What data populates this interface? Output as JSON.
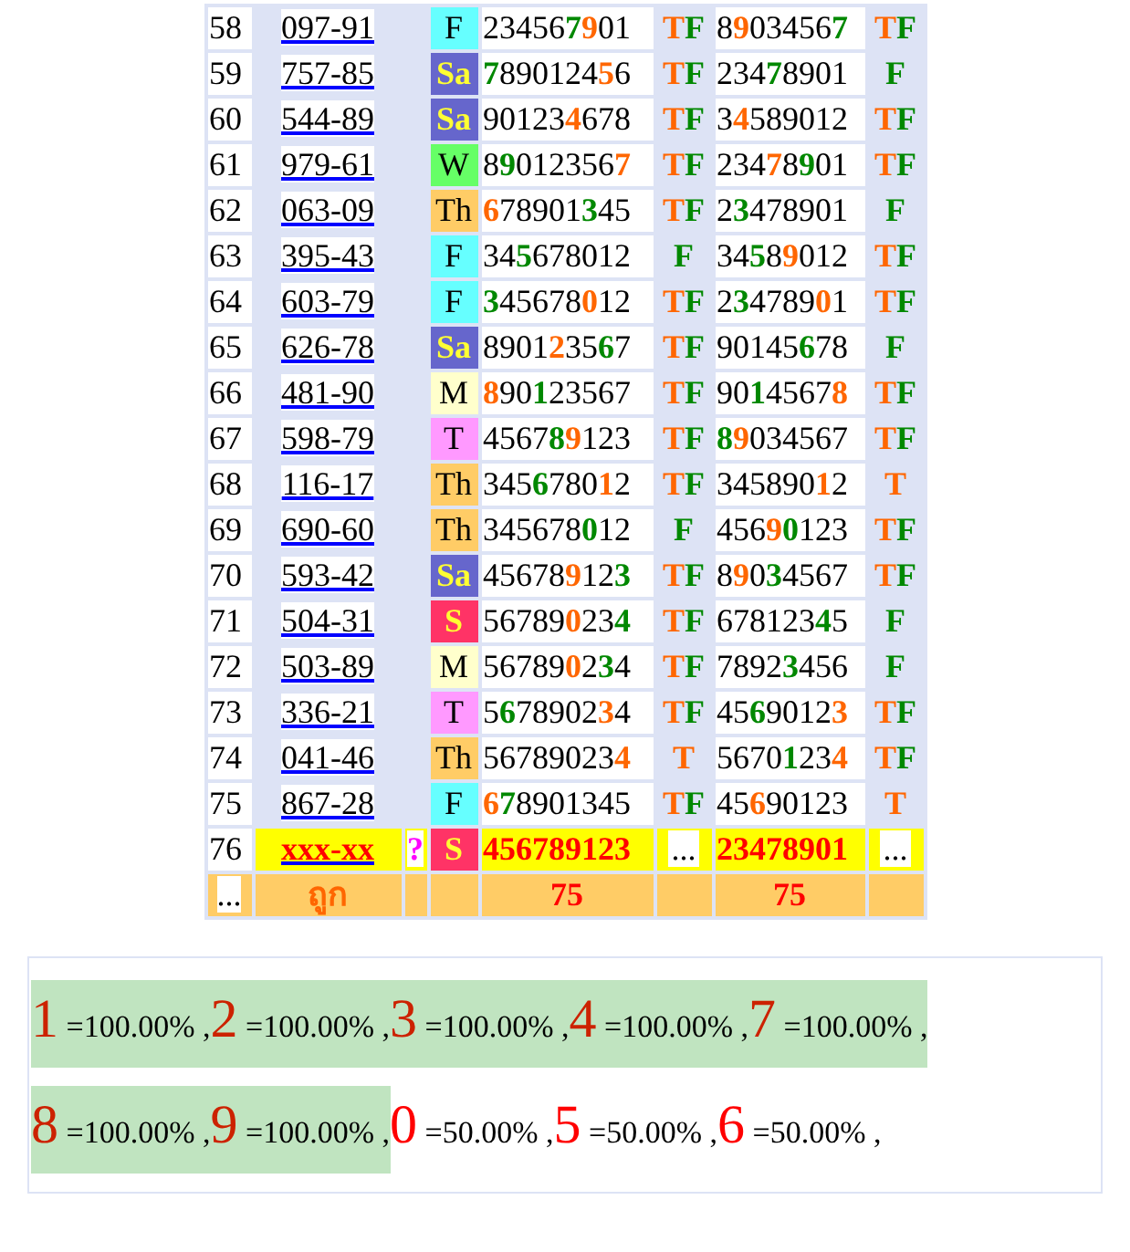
{
  "rows": [
    {
      "kind": "done",
      "num": "58",
      "code": "097-91",
      "day": "F",
      "color": "#66ffff",
      "n1": [
        {
          "text": "23456"
        },
        {
          "text": "7",
          "color": "#008800"
        },
        {
          "text": "9",
          "color": "#ff6600"
        },
        {
          "text": "01"
        }
      ],
      "t1": [
        {
          "text": "T",
          "color": "#ff6600"
        },
        {
          "text": "F",
          "color": "#008800"
        }
      ],
      "n2": [
        {
          "text": "8"
        },
        {
          "text": "9",
          "color": "#ff6600"
        },
        {
          "text": "03456"
        },
        {
          "text": "7",
          "color": "#008800"
        }
      ],
      "t2": [
        {
          "text": "T",
          "color": "#ff6600"
        },
        {
          "text": "F",
          "color": "#008800"
        }
      ]
    },
    {
      "kind": "done",
      "num": "59",
      "code": "757-85",
      "day": "Sa",
      "color": "#6666cc",
      "n1": [
        {
          "text": "7",
          "color": "#008800"
        },
        {
          "text": "890124"
        },
        {
          "text": "5",
          "color": "#ff6600"
        },
        {
          "text": "6"
        }
      ],
      "t1": [
        {
          "text": "T",
          "color": "#ff6600"
        },
        {
          "text": "F",
          "color": "#008800"
        }
      ],
      "n2": [
        {
          "text": "234"
        },
        {
          "text": "7",
          "color": "#008800"
        },
        {
          "text": "8901"
        }
      ],
      "t2": [
        {
          "text": "F",
          "color": "#008800"
        }
      ]
    },
    {
      "kind": "done",
      "num": "60",
      "code": "544-89",
      "day": "Sa",
      "color": "#6666cc",
      "n1": [
        {
          "text": "90123"
        },
        {
          "text": "4",
          "color": "#ff6600"
        },
        {
          "text": "678"
        }
      ],
      "t1": [
        {
          "text": "T",
          "color": "#ff6600"
        },
        {
          "text": "F",
          "color": "#008800"
        }
      ],
      "n2": [
        {
          "text": "3"
        },
        {
          "text": "4",
          "color": "#ff6600"
        },
        {
          "text": "589012"
        }
      ],
      "t2": [
        {
          "text": "T",
          "color": "#ff6600"
        },
        {
          "text": "F",
          "color": "#008800"
        }
      ]
    },
    {
      "kind": "done",
      "num": "61",
      "code": "979-61",
      "day": "W",
      "color": "#66ff66",
      "n1": [
        {
          "text": "8"
        },
        {
          "text": "9",
          "color": "#008800"
        },
        {
          "text": "012356"
        },
        {
          "text": "7",
          "color": "#ff6600"
        }
      ],
      "t1": [
        {
          "text": "T",
          "color": "#ff6600"
        },
        {
          "text": "F",
          "color": "#008800"
        }
      ],
      "n2": [
        {
          "text": "234"
        },
        {
          "text": "7",
          "color": "#ff6600"
        },
        {
          "text": "8"
        },
        {
          "text": "9",
          "color": "#008800"
        },
        {
          "text": "01"
        }
      ],
      "t2": [
        {
          "text": "T",
          "color": "#ff6600"
        },
        {
          "text": "F",
          "color": "#008800"
        }
      ]
    },
    {
      "kind": "done",
      "num": "62",
      "code": "063-09",
      "day": "Th",
      "color": "#ffcc66",
      "n1": [
        {
          "text": "6",
          "color": "#ff6600"
        },
        {
          "text": "78901"
        },
        {
          "text": "3",
          "color": "#008800"
        },
        {
          "text": "45"
        }
      ],
      "t1": [
        {
          "text": "T",
          "color": "#ff6600"
        },
        {
          "text": "F",
          "color": "#008800"
        }
      ],
      "n2": [
        {
          "text": "2"
        },
        {
          "text": "3",
          "color": "#008800"
        },
        {
          "text": "478901"
        }
      ],
      "t2": [
        {
          "text": "F",
          "color": "#008800"
        }
      ]
    },
    {
      "kind": "done",
      "num": "63",
      "code": "395-43",
      "day": "F",
      "color": "#66ffff",
      "n1": [
        {
          "text": "34"
        },
        {
          "text": "5",
          "color": "#008800"
        },
        {
          "text": "678012"
        }
      ],
      "t1": [
        {
          "text": "F",
          "color": "#008800"
        }
      ],
      "n2": [
        {
          "text": "34"
        },
        {
          "text": "5",
          "color": "#008800"
        },
        {
          "text": "8"
        },
        {
          "text": "9",
          "color": "#ff6600"
        },
        {
          "text": "012"
        }
      ],
      "t2": [
        {
          "text": "T",
          "color": "#ff6600"
        },
        {
          "text": "F",
          "color": "#008800"
        }
      ]
    },
    {
      "kind": "done",
      "num": "64",
      "code": "603-79",
      "day": "F",
      "color": "#66ffff",
      "n1": [
        {
          "text": "3",
          "color": "#008800"
        },
        {
          "text": "45678"
        },
        {
          "text": "0",
          "color": "#ff6600"
        },
        {
          "text": "12"
        }
      ],
      "t1": [
        {
          "text": "T",
          "color": "#ff6600"
        },
        {
          "text": "F",
          "color": "#008800"
        }
      ],
      "n2": [
        {
          "text": "2"
        },
        {
          "text": "3",
          "color": "#008800"
        },
        {
          "text": "4789"
        },
        {
          "text": "0",
          "color": "#ff6600"
        },
        {
          "text": "1"
        }
      ],
      "t2": [
        {
          "text": "T",
          "color": "#ff6600"
        },
        {
          "text": "F",
          "color": "#008800"
        }
      ]
    },
    {
      "kind": "done",
      "num": "65",
      "code": "626-78",
      "day": "Sa",
      "color": "#6666cc",
      "n1": [
        {
          "text": "8901"
        },
        {
          "text": "2",
          "color": "#ff6600"
        },
        {
          "text": "35"
        },
        {
          "text": "6",
          "color": "#008800"
        },
        {
          "text": "7"
        }
      ],
      "t1": [
        {
          "text": "T",
          "color": "#ff6600"
        },
        {
          "text": "F",
          "color": "#008800"
        }
      ],
      "n2": [
        {
          "text": "90145"
        },
        {
          "text": "6",
          "color": "#008800"
        },
        {
          "text": "78"
        }
      ],
      "t2": [
        {
          "text": "F",
          "color": "#008800"
        }
      ]
    },
    {
      "kind": "done",
      "num": "66",
      "code": "481-90",
      "day": "M",
      "color": "#ffffcc",
      "n1": [
        {
          "text": "8",
          "color": "#ff6600"
        },
        {
          "text": "90"
        },
        {
          "text": "1",
          "color": "#008800"
        },
        {
          "text": "23567"
        }
      ],
      "t1": [
        {
          "text": "T",
          "color": "#ff6600"
        },
        {
          "text": "F",
          "color": "#008800"
        }
      ],
      "n2": [
        {
          "text": "90"
        },
        {
          "text": "1",
          "color": "#008800"
        },
        {
          "text": "4567"
        },
        {
          "text": "8",
          "color": "#ff6600"
        }
      ],
      "t2": [
        {
          "text": "T",
          "color": "#ff6600"
        },
        {
          "text": "F",
          "color": "#008800"
        }
      ]
    },
    {
      "kind": "done",
      "num": "67",
      "code": "598-79",
      "day": "T",
      "color": "#ff99ff",
      "n1": [
        {
          "text": "4567"
        },
        {
          "text": "8",
          "color": "#008800"
        },
        {
          "text": "9",
          "color": "#ff6600"
        },
        {
          "text": "123"
        }
      ],
      "t1": [
        {
          "text": "T",
          "color": "#ff6600"
        },
        {
          "text": "F",
          "color": "#008800"
        }
      ],
      "n2": [
        {
          "text": "8",
          "color": "#008800"
        },
        {
          "text": "9",
          "color": "#ff6600"
        },
        {
          "text": "034567"
        }
      ],
      "t2": [
        {
          "text": "T",
          "color": "#ff6600"
        },
        {
          "text": "F",
          "color": "#008800"
        }
      ]
    },
    {
      "kind": "done",
      "num": "68",
      "code": "116-17",
      "day": "Th",
      "color": "#ffcc66",
      "n1": [
        {
          "text": "345"
        },
        {
          "text": "6",
          "color": "#008800"
        },
        {
          "text": "780"
        },
        {
          "text": "1",
          "color": "#ff6600"
        },
        {
          "text": "2"
        }
      ],
      "t1": [
        {
          "text": "T",
          "color": "#ff6600"
        },
        {
          "text": "F",
          "color": "#008800"
        }
      ],
      "n2": [
        {
          "text": "345890"
        },
        {
          "text": "1",
          "color": "#ff6600"
        },
        {
          "text": "2"
        }
      ],
      "t2": [
        {
          "text": "T",
          "color": "#ff6600"
        }
      ]
    },
    {
      "kind": "done",
      "num": "69",
      "code": "690-60",
      "day": "Th",
      "color": "#ffcc66",
      "n1": [
        {
          "text": "345678"
        },
        {
          "text": "0",
          "color": "#008800"
        },
        {
          "text": "12"
        }
      ],
      "t1": [
        {
          "text": "F",
          "color": "#008800"
        }
      ],
      "n2": [
        {
          "text": "456"
        },
        {
          "text": "9",
          "color": "#ff6600"
        },
        {
          "text": "0",
          "color": "#008800"
        },
        {
          "text": "123"
        }
      ],
      "t2": [
        {
          "text": "T",
          "color": "#ff6600"
        },
        {
          "text": "F",
          "color": "#008800"
        }
      ]
    },
    {
      "kind": "done",
      "num": "70",
      "code": "593-42",
      "day": "Sa",
      "color": "#6666cc",
      "n1": [
        {
          "text": "45678"
        },
        {
          "text": "9",
          "color": "#ff6600"
        },
        {
          "text": "12"
        },
        {
          "text": "3",
          "color": "#008800"
        }
      ],
      "t1": [
        {
          "text": "T",
          "color": "#ff6600"
        },
        {
          "text": "F",
          "color": "#008800"
        }
      ],
      "n2": [
        {
          "text": "8"
        },
        {
          "text": "9",
          "color": "#ff6600"
        },
        {
          "text": "0"
        },
        {
          "text": "3",
          "color": "#008800"
        },
        {
          "text": "4567"
        }
      ],
      "t2": [
        {
          "text": "T",
          "color": "#ff6600"
        },
        {
          "text": "F",
          "color": "#008800"
        }
      ]
    },
    {
      "kind": "done",
      "num": "71",
      "code": "504-31",
      "day": "S",
      "color": "#ff3366",
      "n1": [
        {
          "text": "56789"
        },
        {
          "text": "0",
          "color": "#ff6600"
        },
        {
          "text": "23"
        },
        {
          "text": "4",
          "color": "#008800"
        }
      ],
      "t1": [
        {
          "text": "T",
          "color": "#ff6600"
        },
        {
          "text": "F",
          "color": "#008800"
        }
      ],
      "n2": [
        {
          "text": "678123"
        },
        {
          "text": "4",
          "color": "#008800"
        },
        {
          "text": "5"
        }
      ],
      "t2": [
        {
          "text": "F",
          "color": "#008800"
        }
      ]
    },
    {
      "kind": "done",
      "num": "72",
      "code": "503-89",
      "day": "M",
      "color": "#ffffcc",
      "n1": [
        {
          "text": "56789"
        },
        {
          "text": "0",
          "color": "#ff6600"
        },
        {
          "text": "2"
        },
        {
          "text": "3",
          "color": "#008800"
        },
        {
          "text": "4"
        }
      ],
      "t1": [
        {
          "text": "T",
          "color": "#ff6600"
        },
        {
          "text": "F",
          "color": "#008800"
        }
      ],
      "n2": [
        {
          "text": "7892"
        },
        {
          "text": "3",
          "color": "#008800"
        },
        {
          "text": "456"
        }
      ],
      "t2": [
        {
          "text": "F",
          "color": "#008800"
        }
      ]
    },
    {
      "kind": "done",
      "num": "73",
      "code": "336-21",
      "day": "T",
      "color": "#ff99ff",
      "n1": [
        {
          "text": "5"
        },
        {
          "text": "6",
          "color": "#008800"
        },
        {
          "text": "78902"
        },
        {
          "text": "3",
          "color": "#ff6600"
        },
        {
          "text": "4"
        }
      ],
      "t1": [
        {
          "text": "T",
          "color": "#ff6600"
        },
        {
          "text": "F",
          "color": "#008800"
        }
      ],
      "n2": [
        {
          "text": "45"
        },
        {
          "text": "6",
          "color": "#008800"
        },
        {
          "text": "9012"
        },
        {
          "text": "3",
          "color": "#ff6600"
        }
      ],
      "t2": [
        {
          "text": "T",
          "color": "#ff6600"
        },
        {
          "text": "F",
          "color": "#008800"
        }
      ]
    },
    {
      "kind": "done",
      "num": "74",
      "code": "041-46",
      "day": "Th",
      "color": "#ffcc66",
      "n1": [
        {
          "text": "56789023"
        },
        {
          "text": "4",
          "color": "#ff6600"
        }
      ],
      "t1": [
        {
          "text": "T",
          "color": "#ff6600"
        }
      ],
      "n2": [
        {
          "text": "5670"
        },
        {
          "text": "1",
          "color": "#008800"
        },
        {
          "text": "23"
        },
        {
          "text": "4",
          "color": "#ff6600"
        }
      ],
      "t2": [
        {
          "text": "T",
          "color": "#ff6600"
        },
        {
          "text": "F",
          "color": "#008800"
        }
      ]
    },
    {
      "kind": "done",
      "num": "75",
      "code": "867-28",
      "day": "F",
      "color": "#66ffff",
      "n1": [
        {
          "text": "6",
          "color": "#ff6600"
        },
        {
          "text": "7",
          "color": "#008800"
        },
        {
          "text": "8901345"
        }
      ],
      "t1": [
        {
          "text": "T",
          "color": "#ff6600"
        },
        {
          "text": "F",
          "color": "#008800"
        }
      ],
      "n2": [
        {
          "text": "45"
        },
        {
          "text": "6",
          "color": "#ff6600"
        },
        {
          "text": "90123"
        }
      ],
      "t2": [
        {
          "text": "T",
          "color": "#ff6600"
        }
      ]
    },
    {
      "kind": "pending",
      "num": "76",
      "code": "xxx-xx",
      "query": "?",
      "day": "S",
      "color": "#ff3366",
      "n1": [
        {
          "text": "456789123",
          "color": "#ff0000"
        }
      ],
      "t1": [
        {
          "text": "...",
          "boxed": true
        }
      ],
      "n2": [
        {
          "text": "23478901",
          "color": "#ff0000"
        }
      ],
      "t2": [
        {
          "text": "...",
          "boxed": true
        }
      ]
    }
  ],
  "footer": {
    "mark": "...",
    "label": "ถูก",
    "hits1": "75",
    "hits2": "75"
  },
  "stats": [
    {
      "digit": "1",
      "value": "=100.00%",
      "sep": ",",
      "highlighted": true
    },
    {
      "digit": "2",
      "value": "=100.00%",
      "sep": ",",
      "highlighted": true
    },
    {
      "digit": "3",
      "value": "=100.00%",
      "sep": ",",
      "highlighted": true
    },
    {
      "digit": "4",
      "value": "=100.00%",
      "sep": ",",
      "highlighted": true
    },
    {
      "digit": "7",
      "value": "=100.00%",
      "sep": ",",
      "highlighted": true
    },
    {
      "digit": "8",
      "value": "=100.00%",
      "sep": ",",
      "highlighted": true
    },
    {
      "digit": "9",
      "value": "=100.00%",
      "sep": ",",
      "highlighted": true
    },
    {
      "digit": "0",
      "value": "=50.00%",
      "sep": ",",
      "highlighted": false
    },
    {
      "digit": "5",
      "value": "=50.00%",
      "sep": ",",
      "highlighted": false
    },
    {
      "digit": "6",
      "value": "=50.00%",
      "sep": ",",
      "highlighted": false
    }
  ]
}
